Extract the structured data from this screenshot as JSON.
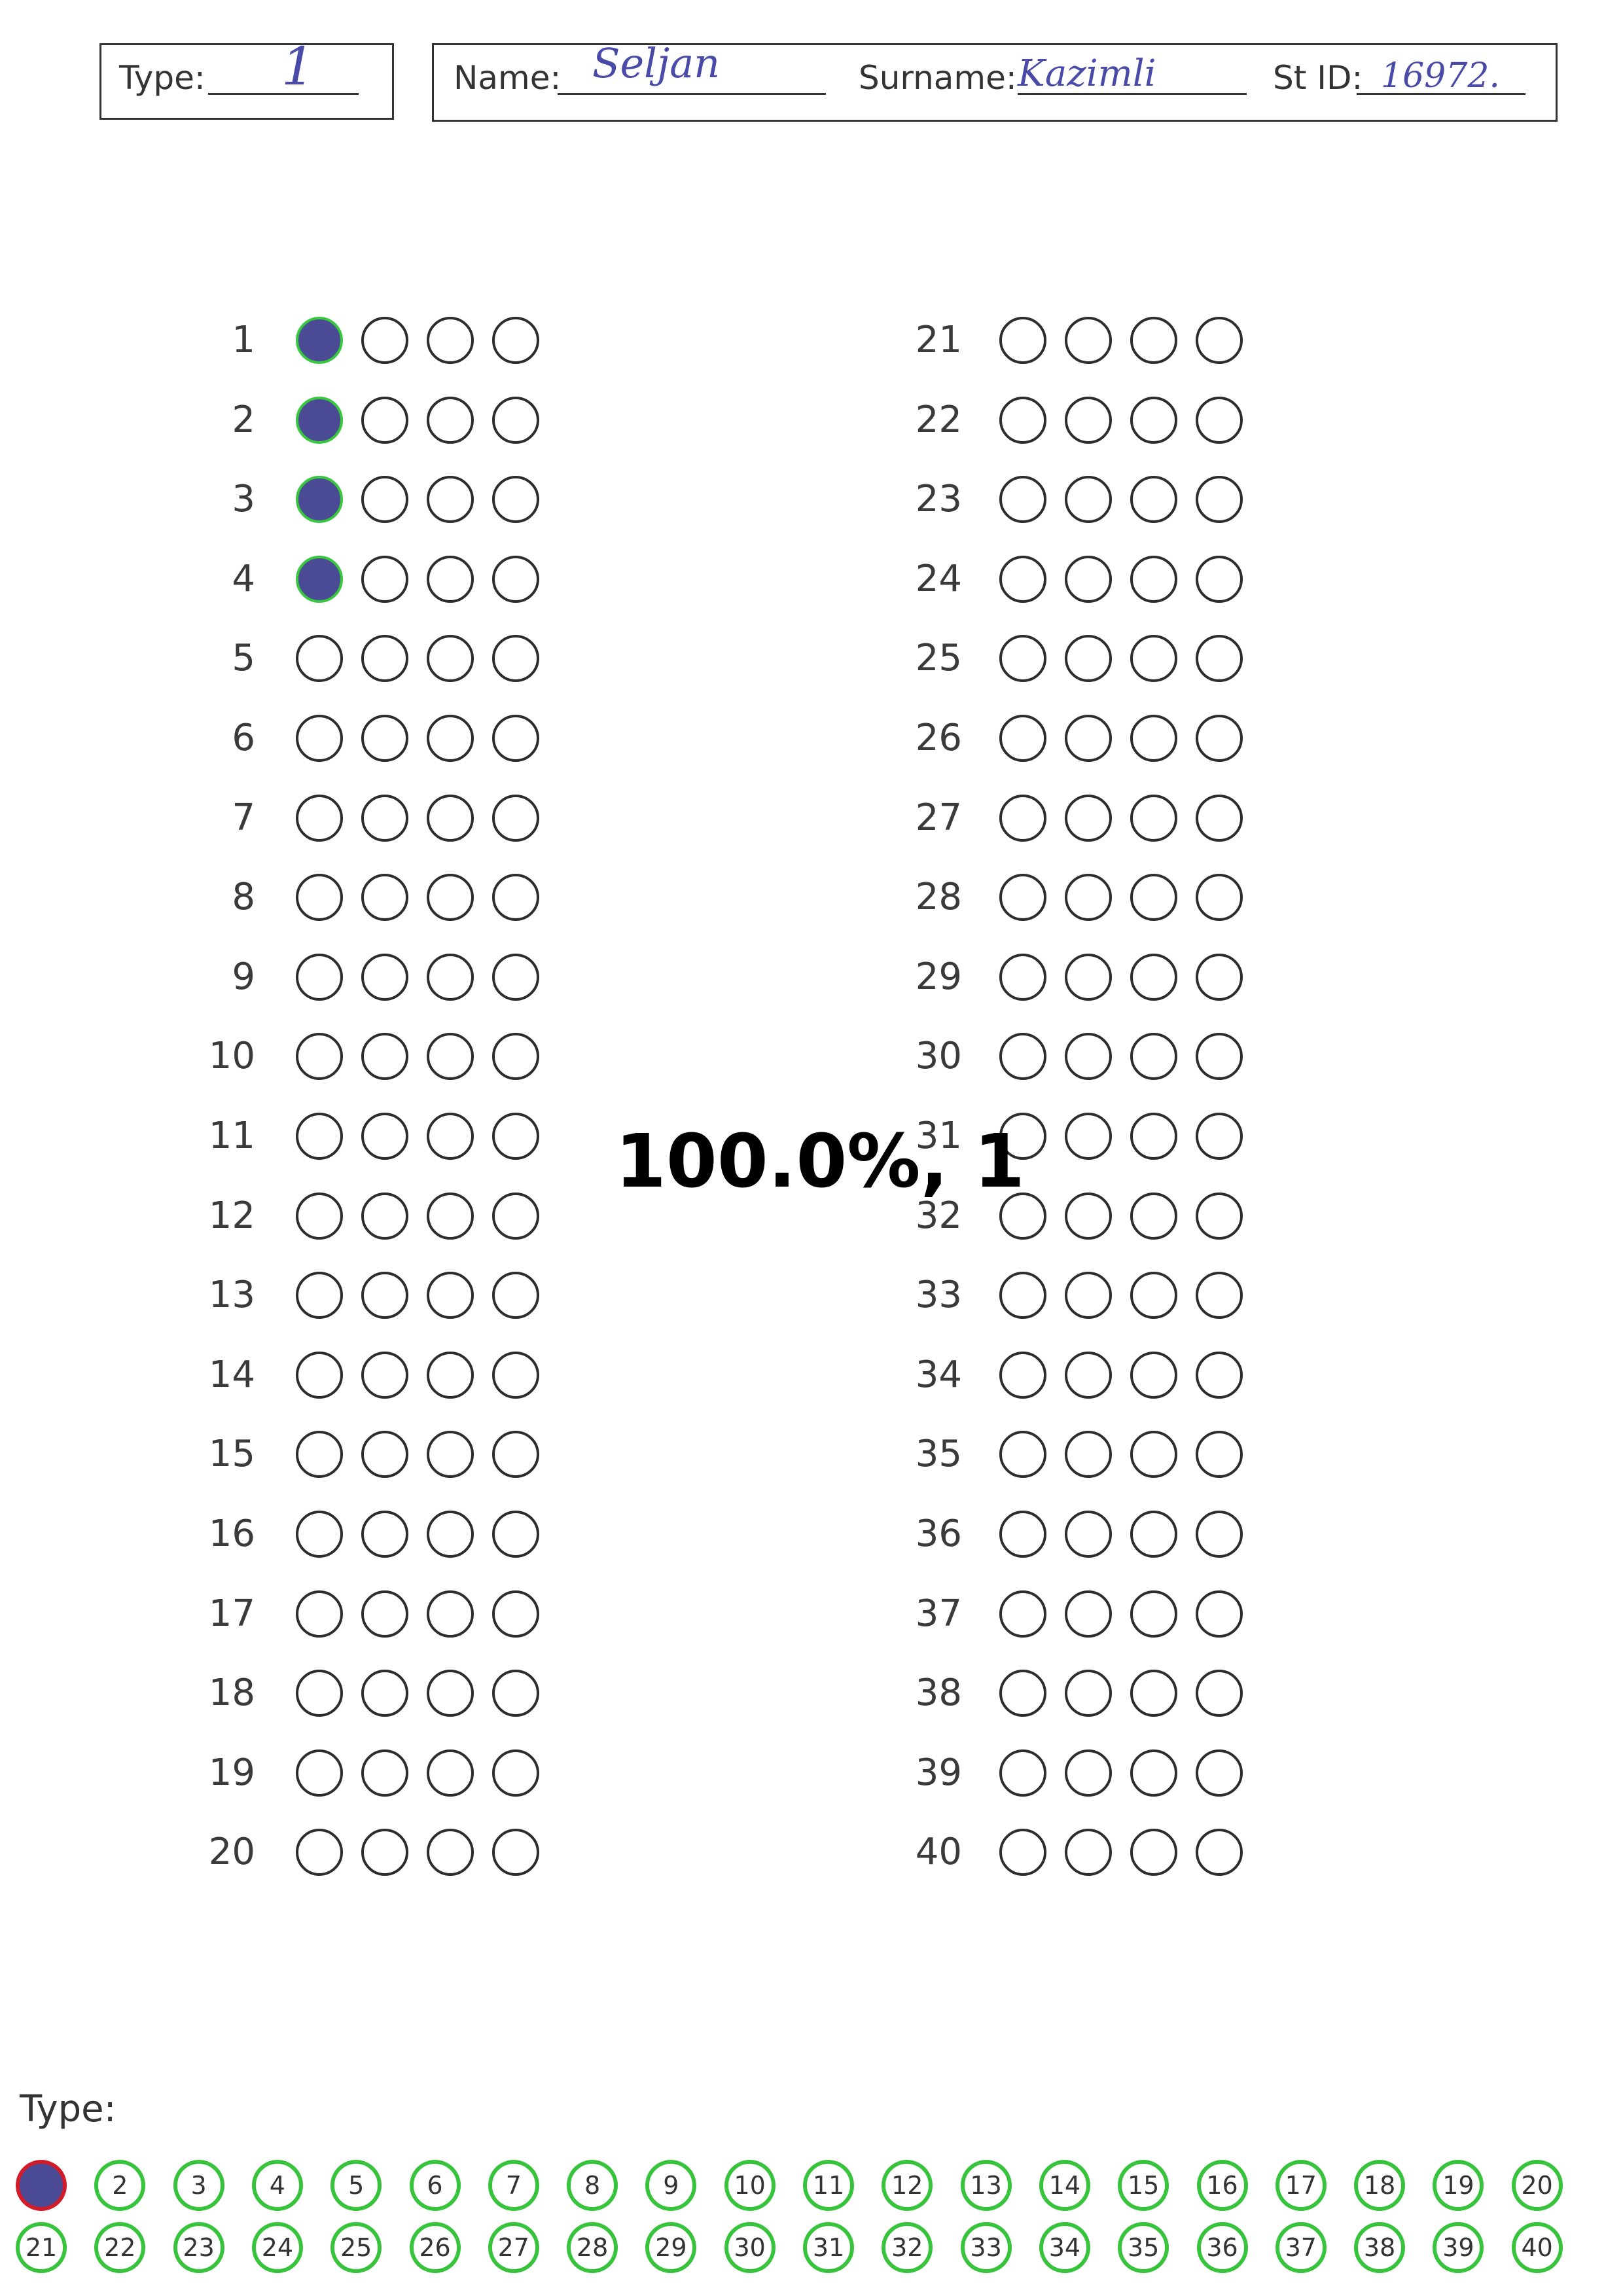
{
  "header": {
    "type_label": "Type:",
    "type_value": "1",
    "name_label": "Name:",
    "name_value": "Seljan",
    "surname_label": "Surname:",
    "surname_value": "Kazimli",
    "stid_label": "St ID:",
    "stid_value": "16972."
  },
  "score_text": "100.0%, 1",
  "colors": {
    "fill": "#4b4a94",
    "correct_ring": "#39c73f",
    "selected_type_ring": "#d11d2a"
  },
  "questions": [
    {
      "num": "1",
      "marked": [
        1
      ]
    },
    {
      "num": "2",
      "marked": [
        1
      ]
    },
    {
      "num": "3",
      "marked": [
        1
      ]
    },
    {
      "num": "4",
      "marked": [
        1
      ]
    },
    {
      "num": "5",
      "marked": []
    },
    {
      "num": "6",
      "marked": []
    },
    {
      "num": "7",
      "marked": []
    },
    {
      "num": "8",
      "marked": []
    },
    {
      "num": "9",
      "marked": []
    },
    {
      "num": "10",
      "marked": []
    },
    {
      "num": "11",
      "marked": []
    },
    {
      "num": "12",
      "marked": []
    },
    {
      "num": "13",
      "marked": []
    },
    {
      "num": "14",
      "marked": []
    },
    {
      "num": "15",
      "marked": []
    },
    {
      "num": "16",
      "marked": []
    },
    {
      "num": "17",
      "marked": []
    },
    {
      "num": "18",
      "marked": []
    },
    {
      "num": "19",
      "marked": []
    },
    {
      "num": "20",
      "marked": []
    },
    {
      "num": "21",
      "marked": []
    },
    {
      "num": "22",
      "marked": []
    },
    {
      "num": "23",
      "marked": []
    },
    {
      "num": "24",
      "marked": []
    },
    {
      "num": "25",
      "marked": []
    },
    {
      "num": "26",
      "marked": []
    },
    {
      "num": "27",
      "marked": []
    },
    {
      "num": "28",
      "marked": []
    },
    {
      "num": "29",
      "marked": []
    },
    {
      "num": "30",
      "marked": []
    },
    {
      "num": "31",
      "marked": []
    },
    {
      "num": "32",
      "marked": []
    },
    {
      "num": "33",
      "marked": []
    },
    {
      "num": "34",
      "marked": []
    },
    {
      "num": "35",
      "marked": []
    },
    {
      "num": "36",
      "marked": []
    },
    {
      "num": "37",
      "marked": []
    },
    {
      "num": "38",
      "marked": []
    },
    {
      "num": "39",
      "marked": []
    },
    {
      "num": "40",
      "marked": []
    }
  ],
  "type_selector": {
    "label": "Type:",
    "selected": "1",
    "options": [
      "1",
      "2",
      "3",
      "4",
      "5",
      "6",
      "7",
      "8",
      "9",
      "10",
      "11",
      "12",
      "13",
      "14",
      "15",
      "16",
      "17",
      "18",
      "19",
      "20",
      "21",
      "22",
      "23",
      "24",
      "25",
      "26",
      "27",
      "28",
      "29",
      "30",
      "31",
      "32",
      "33",
      "34",
      "35",
      "36",
      "37",
      "38",
      "39",
      "40"
    ]
  }
}
